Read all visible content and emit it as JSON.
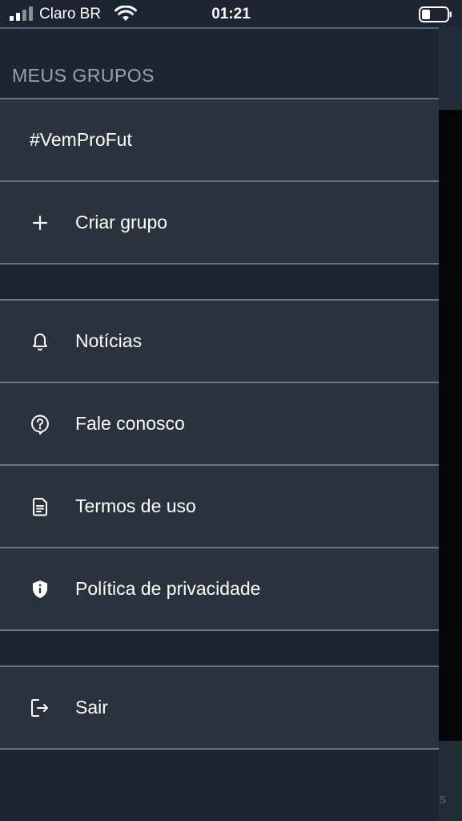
{
  "status_bar": {
    "carrier": "Claro BR",
    "time": "01:21"
  },
  "drawer": {
    "section_title": "MEUS GRUPOS",
    "groups": [
      {
        "label": "#VemProFut"
      }
    ],
    "create_group": {
      "label": "Criar grupo",
      "icon": "plus-icon"
    },
    "menu": [
      {
        "label": "Notícias",
        "icon": "bell-icon"
      },
      {
        "label": "Fale conosco",
        "icon": "help-bubble-icon"
      },
      {
        "label": "Termos de uso",
        "icon": "document-icon"
      },
      {
        "label": "Política de privacidade",
        "icon": "shield-icon"
      }
    ],
    "logout": {
      "label": "Sair",
      "icon": "logout-icon"
    }
  },
  "background": {
    "partial_text": "s"
  },
  "colors": {
    "drawer_bg": "#1c2532",
    "row_bg": "#2a323e",
    "divider": "#6b747e",
    "section_title": "#9aa1a9"
  }
}
